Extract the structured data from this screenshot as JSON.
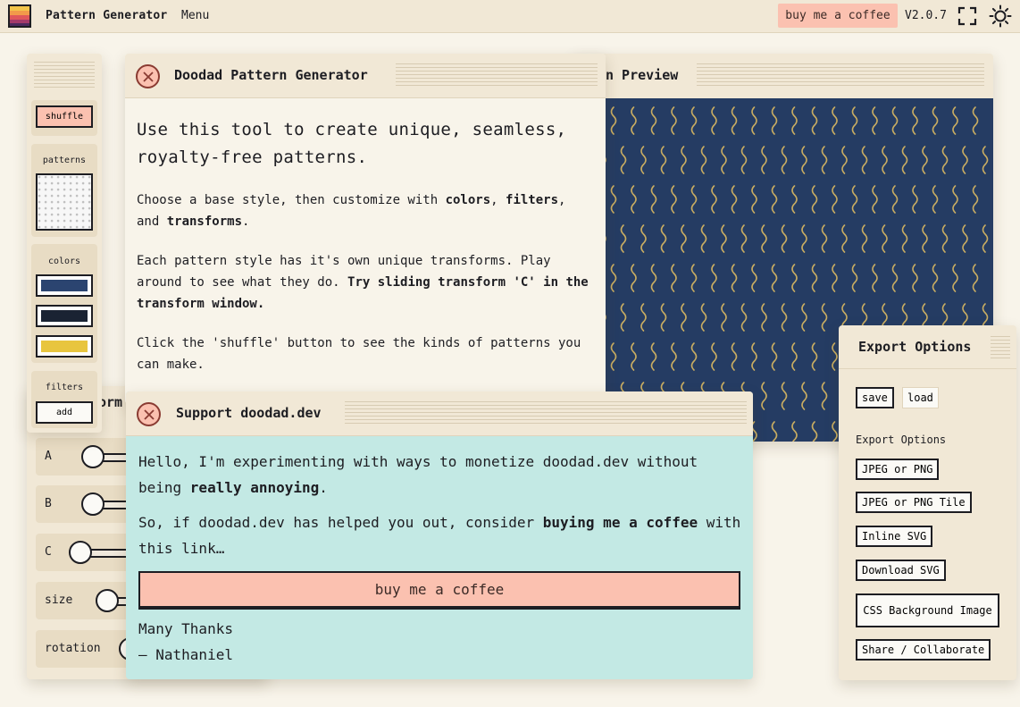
{
  "header": {
    "app_title": "Pattern Generator",
    "menu_label": "Menu",
    "coffee_label": "buy me a coffee",
    "version": "V2.0.7"
  },
  "toolbar": {
    "shuffle_label": "shuffle",
    "patterns_label": "patterns",
    "colors_label": "colors",
    "colors": [
      "#2b4470",
      "#1a2333",
      "#e8c53e"
    ],
    "filters_label": "filters",
    "add_label": "add"
  },
  "transform_panel": {
    "title_fragment": "orm",
    "sliders": [
      {
        "label": "A",
        "value": 0.05
      },
      {
        "label": "B",
        "value": 0.05
      },
      {
        "label": "C",
        "value": 0.0
      },
      {
        "label": "size",
        "value": 0.1
      },
      {
        "label": "rotation",
        "value": 0.1
      }
    ]
  },
  "preview": {
    "title_fragment": "n Preview",
    "background": "#253c63",
    "stroke": "#c9ad62"
  },
  "about": {
    "title": "Doodad Pattern Generator",
    "lead": "Use this tool to create unique, seamless, royalty-free patterns.",
    "p1_a": "Choose a base style, then customize with ",
    "p1_b": "colors",
    "p1_c": ", ",
    "p1_d": "filters",
    "p1_e": ", and ",
    "p1_f": "transforms",
    "p1_g": ".",
    "p2_a": "Each pattern style has it's own unique transforms. Play around to see what they do. ",
    "p2_b": "Try sliding transform 'C' in the transform window.",
    "p3": "Click the 'shuffle' button to see the kinds of patterns you can make."
  },
  "support": {
    "title": "Support doodad.dev",
    "p1_a": "Hello, I'm experimenting with ways to monetize doodad.dev without being ",
    "p1_b": "really annoying",
    "p1_c": ".",
    "p2_a": "So, if doodad.dev has helped you out, consider ",
    "p2_b": "buying me a coffee",
    "p2_c": " with this link…",
    "button_label": "buy me a coffee",
    "thanks": "Many Thanks",
    "signature": "— Nathaniel"
  },
  "export": {
    "title": "Export Options",
    "save_label": "save",
    "load_label": "load",
    "subtitle": "Export Options",
    "jpeg_png": "JPEG or PNG",
    "jpeg_png_tile": "JPEG or PNG Tile",
    "inline_svg": "Inline SVG",
    "download_svg": "Download SVG",
    "css_bg": "CSS Background Image",
    "share": "Share / Collaborate"
  }
}
